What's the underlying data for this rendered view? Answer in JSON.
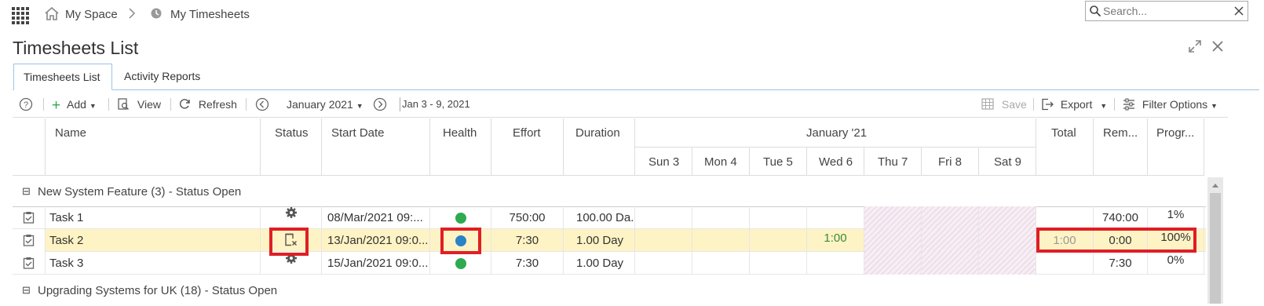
{
  "breadcrumb": {
    "home": "My Space",
    "current": "My Timesheets"
  },
  "search": {
    "placeholder": "Search..."
  },
  "page": {
    "title": "Timesheets List"
  },
  "tabs": [
    {
      "label": "Timesheets List"
    },
    {
      "label": "Activity Reports"
    }
  ],
  "toolbar": {
    "add": "Add",
    "view": "View",
    "refresh": "Refresh",
    "period": "January 2021",
    "range": "Jan 3 - 9, 2021",
    "save": "Save",
    "export": "Export",
    "filter": "Filter Options"
  },
  "columns": {
    "name": "Name",
    "status": "Status",
    "start_date": "Start Date",
    "health": "Health",
    "effort": "Effort",
    "duration": "Duration",
    "month": "January '21",
    "days": [
      "Sun 3",
      "Mon 4",
      "Tue 5",
      "Wed 6",
      "Thu 7",
      "Fri 8",
      "Sat 9"
    ],
    "total": "Total",
    "remaining": "Rem...",
    "progress": "Progr..."
  },
  "groups": [
    {
      "label": "New System Feature (3) - Status Open"
    },
    {
      "label": "Upgrading Systems for UK (18) - Status Open"
    }
  ],
  "rows": [
    {
      "name": "Task 1",
      "status_icon": "gear-icon",
      "start": "08/Mar/2021 09:...",
      "health_color": "#2eaa4f",
      "effort": "750:00",
      "duration": "100.00 Da...",
      "wed": "",
      "total": "",
      "remaining": "740:00",
      "progress": "1%"
    },
    {
      "name": "Task 2",
      "status_icon": "cancelled-task-icon",
      "start": "13/Jan/2021 09:0...",
      "health_color": "#2a82c8",
      "effort": "7:30",
      "duration": "1.00 Day",
      "wed": "1:00",
      "total": "1:00",
      "remaining": "0:00",
      "progress": "100%"
    },
    {
      "name": "Task 3",
      "status_icon": "gear-icon",
      "start": "15/Jan/2021 09:0...",
      "health_color": "#2eaa4f",
      "effort": "7:30",
      "duration": "1.00 Day",
      "wed": "",
      "total": "",
      "remaining": "7:30",
      "progress": "0%"
    }
  ]
}
